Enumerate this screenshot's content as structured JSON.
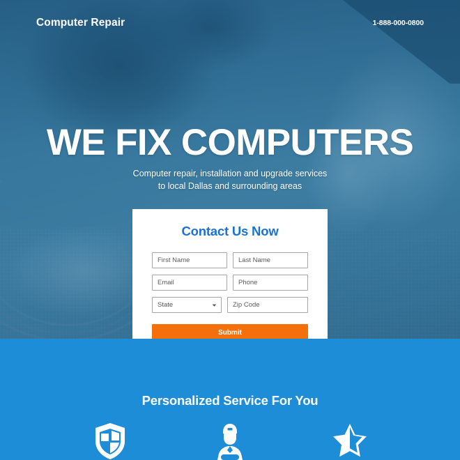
{
  "header": {
    "logo": "Computer Repair",
    "phone": "1-888-000-0800"
  },
  "hero": {
    "headline": "WE FIX COMPUTERS",
    "subheadline_line1": "Computer repair, installation and upgrade services",
    "subheadline_line2": "to local Dallas and surrounding areas"
  },
  "form": {
    "title": "Contact Us Now",
    "fields": {
      "first_name": {
        "placeholder": "First Name",
        "value": ""
      },
      "last_name": {
        "placeholder": "Last Name",
        "value": ""
      },
      "email": {
        "placeholder": "Email",
        "value": ""
      },
      "phone": {
        "placeholder": "Phone",
        "value": ""
      },
      "state": {
        "selected": "State"
      },
      "zip": {
        "placeholder": "Zip Code",
        "value": ""
      }
    },
    "submit_label": "Submit"
  },
  "features": {
    "title": "Personalized Service For You",
    "items": [
      {
        "icon": "shield-icon"
      },
      {
        "icon": "support-technician-icon"
      },
      {
        "icon": "half-star-icon"
      }
    ]
  },
  "colors": {
    "brand_blue": "#1e8dd8",
    "link_blue": "#1a73d0",
    "cta_orange": "#f5700a",
    "hero_overlay": "#2e759e",
    "white": "#ffffff"
  }
}
